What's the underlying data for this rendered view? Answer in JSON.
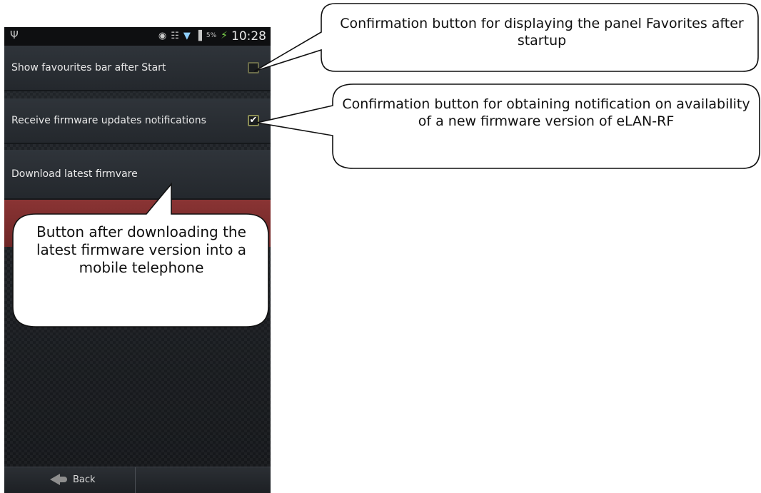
{
  "status_bar": {
    "usb_icon": "usb-icon",
    "battery_percent": "5%",
    "time": "10:28"
  },
  "settings": [
    {
      "label": "Show favourites bar after Start",
      "checked": false
    },
    {
      "label": "Receive firmware updates notifications",
      "checked": true
    },
    {
      "label": "Download latest firmvare"
    }
  ],
  "bottom_bar": {
    "back_label": "Back"
  },
  "callouts": {
    "favorites": "Confirmation button for displaying the panel Favorites after startup",
    "notifications": "Confirmation button for obtaining notification on availability of a new firmware version of eLAN-RF",
    "download": "Button after downloading the latest firmware version into a mobile telephone"
  }
}
